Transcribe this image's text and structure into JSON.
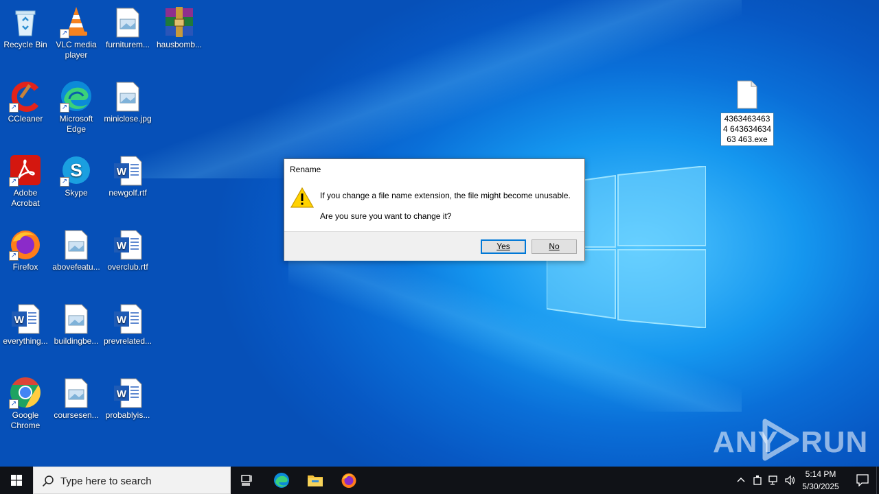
{
  "desktop_icons": [
    {
      "label": "Recycle Bin"
    },
    {
      "label": "VLC media player"
    },
    {
      "label": "furniturem..."
    },
    {
      "label": "hausbomb..."
    },
    {
      "label": "CCleaner"
    },
    {
      "label": "Microsoft Edge"
    },
    {
      "label": "miniclose.jpg"
    },
    {
      "label": "Adobe Acrobat"
    },
    {
      "label": "Skype"
    },
    {
      "label": "newgolf.rtf"
    },
    {
      "label": "Firefox"
    },
    {
      "label": "abovefeatu..."
    },
    {
      "label": "overclub.rtf"
    },
    {
      "label": "everything..."
    },
    {
      "label": "buildingbe..."
    },
    {
      "label": "prevrelated..."
    },
    {
      "label": "Google Chrome"
    },
    {
      "label": "coursesen..."
    },
    {
      "label": "probablyis..."
    }
  ],
  "selected_file": {
    "label": "43634634634 64363463463 463.exe"
  },
  "dialog": {
    "title": "Rename",
    "message": "If you change a file name extension, the file might become unusable.",
    "question": "Are you sure you want to change it?",
    "yes_label": "Yes",
    "no_label": "No"
  },
  "watermark": {
    "left": "ANY",
    "right": "RUN"
  },
  "taskbar": {
    "search_placeholder": "Type here to search",
    "time": "5:14 PM",
    "date": "5/30/2025"
  },
  "colors": {
    "accent": "#0078d7",
    "taskbar": "#101217",
    "desktop": "#0a6fd8"
  }
}
